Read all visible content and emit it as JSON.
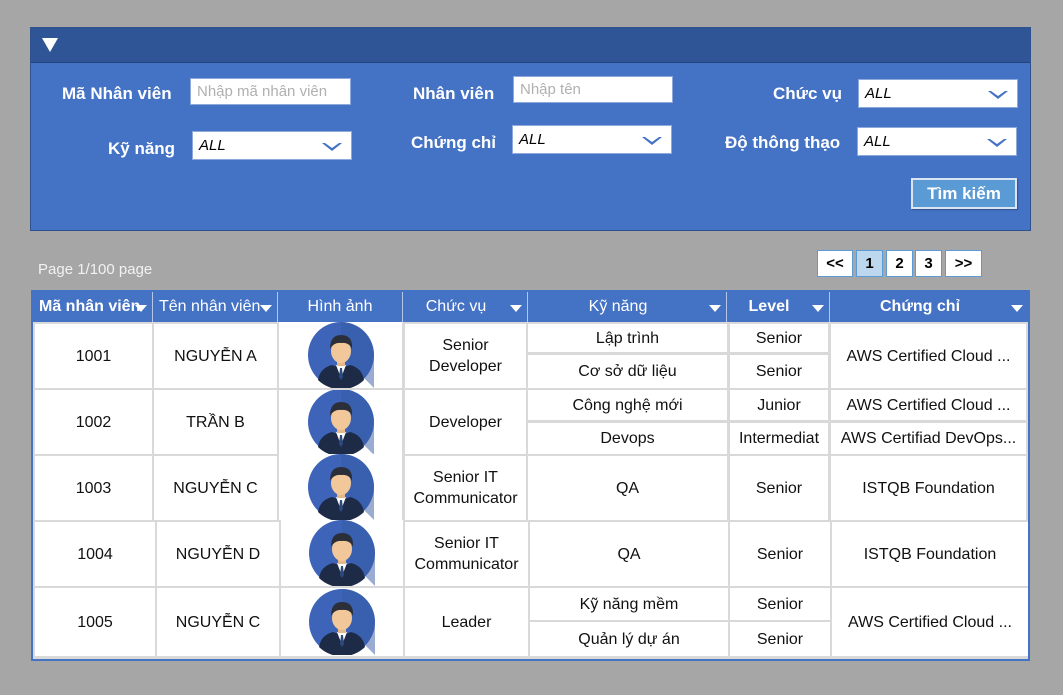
{
  "filter": {
    "employee_id_label": "Mã Nhân viên",
    "employee_id_placeholder": "Nhập mã nhân viên",
    "employee_label": "Nhân viên",
    "employee_placeholder": "Nhập tên",
    "position_label": "Chức vụ",
    "position_value": "ALL",
    "skill_label": "Kỹ năng",
    "skill_value": "ALL",
    "certificate_label": "Chứng chỉ",
    "certificate_value": "ALL",
    "proficiency_label": "Độ thông thạo",
    "proficiency_value": "ALL",
    "search_button": "Tìm kiếm"
  },
  "pagination": {
    "info": "Page 1/100 page",
    "first": "<<",
    "pages": [
      "1",
      "2",
      "3"
    ],
    "last": ">>",
    "current": "1"
  },
  "table": {
    "columns": [
      "Mã nhân viên",
      "Tên nhân viên",
      "Hình ảnh",
      "Chức vụ",
      "Kỹ năng",
      "Level",
      "Chứng chỉ"
    ],
    "rows": [
      {
        "id": "1001",
        "name": "NGUYỄN A",
        "position": "Senior Developer",
        "skills": [
          {
            "skill": "Lập trình",
            "level": "Senior"
          },
          {
            "skill": "Cơ sở dữ liệu",
            "level": "Senior"
          }
        ],
        "certificates": [
          "AWS Certified Cloud ..."
        ]
      },
      {
        "id": "1002",
        "name": "TRẦN B",
        "position": "Developer",
        "skills": [
          {
            "skill": "Công nghệ mới",
            "level": "Junior"
          },
          {
            "skill": "Devops",
            "level": "Intermediat"
          }
        ],
        "certificates": [
          "AWS Certified Cloud ...",
          "AWS Certifiad DevOps..."
        ]
      },
      {
        "id": "1003",
        "name": "NGUYỄN C",
        "position": "Senior IT Communicator",
        "skills": [
          {
            "skill": "QA",
            "level": "Senior"
          }
        ],
        "certificates": [
          "ISTQB Foundation"
        ]
      },
      {
        "id": "1004",
        "name": "NGUYỄN D",
        "position": "Senior IT Communicator",
        "skills": [
          {
            "skill": "QA",
            "level": "Senior"
          }
        ],
        "certificates": [
          "ISTQB Foundation"
        ]
      },
      {
        "id": "1005",
        "name": "NGUYỄN C",
        "position": "Leader",
        "skills": [
          {
            "skill": "Kỹ năng mềm",
            "level": "Senior"
          },
          {
            "skill": "Quản lý dự án",
            "level": "Senior"
          }
        ],
        "certificates": [
          "AWS Certified Cloud ..."
        ]
      }
    ]
  },
  "icons": {
    "collapse": "triangle-down-icon",
    "dropdown": "chevron-down-icon",
    "avatar": "user-avatar-icon"
  },
  "colors": {
    "panel": "#4472c4",
    "panel_header": "#2f5597",
    "button": "#5b9bd5",
    "active_page": "#bdd7ee"
  }
}
